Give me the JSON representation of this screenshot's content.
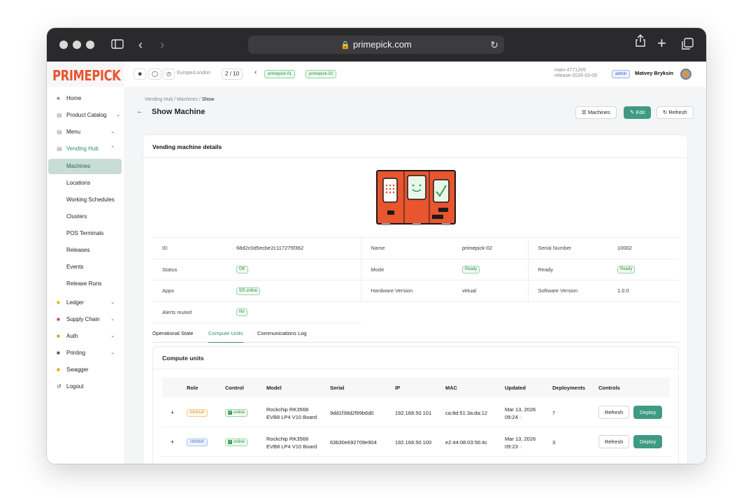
{
  "browser": {
    "url": "primepick.com"
  },
  "app": {
    "logo": "PRIMEPICK"
  },
  "topbar": {
    "timezone": "Europe/London",
    "pager": "2 / 10",
    "machine_tags": [
      "primepick-01",
      "primepick-02"
    ],
    "build_line1": "main-47712e5",
    "build_line2": "release-2026-03-05",
    "role_badge": "admin",
    "user_name": "Matvey Bryksin"
  },
  "sidebar": {
    "items": [
      {
        "label": "Home"
      },
      {
        "label": "Product Catalog"
      },
      {
        "label": "Menu"
      },
      {
        "label": "Vending Hub"
      },
      {
        "label": "Machines"
      },
      {
        "label": "Locations"
      },
      {
        "label": "Working Schedules"
      },
      {
        "label": "Clusters"
      },
      {
        "label": "POS Terminals"
      },
      {
        "label": "Releases"
      },
      {
        "label": "Events"
      },
      {
        "label": "Release Runs"
      },
      {
        "label": "Ledger"
      },
      {
        "label": "Supply Chain"
      },
      {
        "label": "Auth"
      },
      {
        "label": "Printing"
      },
      {
        "label": "Swagger"
      },
      {
        "label": "Logout"
      }
    ]
  },
  "page": {
    "breadcrumb": [
      "Vending Hub",
      "Machines",
      "Show"
    ],
    "title": "Show Machine",
    "actions": {
      "machines": "Machines",
      "edit": "Edit",
      "refresh": "Refresh"
    },
    "card_title": "Vending machine details"
  },
  "details": {
    "id_label": "ID",
    "id_value": "68d2c0d5ecbe2c117275f362",
    "name_label": "Name",
    "name_value": "primepick-02",
    "serial_label": "Serial Number",
    "serial_value": "10002",
    "status_label": "Status",
    "status_value": "OK",
    "mode_label": "Mode",
    "mode_value": "Ready",
    "ready_label": "Ready",
    "ready_value": "Ready",
    "apps_label": "Apps",
    "apps_value": "5/5 online",
    "hw_label": "Hardware Version",
    "hw_value": "virtual",
    "sw_label": "Software Version",
    "sw_value": "1.0.0",
    "alerts_label": "Alerts muted",
    "alerts_value": "No"
  },
  "tabs": [
    "Operational State",
    "Compute Units",
    "Communications Log"
  ],
  "compute_units": {
    "title": "Compute units",
    "columns": [
      "Role",
      "Control",
      "Model",
      "Serial",
      "IP",
      "MAC",
      "Updated",
      "Deployments",
      "Controls"
    ],
    "rows": [
      {
        "expand": "+",
        "role": "PICKUP",
        "control": "online",
        "model_l1": "Rockchip RK3568",
        "model_l2": "EVB8 LP4 V10 Board",
        "serial": "9dd1f38d2f99b6d0",
        "ip": "192.168.50.101",
        "mac": "ca:8d:51:3a:da:12",
        "updated_l1": "Mar 13, 2026",
        "updated_l2": "09:24",
        "deployments": "7",
        "refresh": "Refresh",
        "deploy": "Deploy"
      },
      {
        "expand": "+",
        "role": "ORDER",
        "control": "online",
        "model_l1": "Rockchip RK3568",
        "model_l2": "EVB8 LP4 V10 Board",
        "serial": "63b30e692709e904",
        "ip": "192.168.50.100",
        "mac": "e2:44:08:03:56:4c",
        "updated_l1": "Mar 13, 2026",
        "updated_l2": "09:23",
        "deployments": "3",
        "refresh": "Refresh",
        "deploy": "Deploy"
      }
    ]
  },
  "colors": {
    "accent": "#3f9a83",
    "brand": "#e8552f",
    "machine": "#e8552f"
  }
}
